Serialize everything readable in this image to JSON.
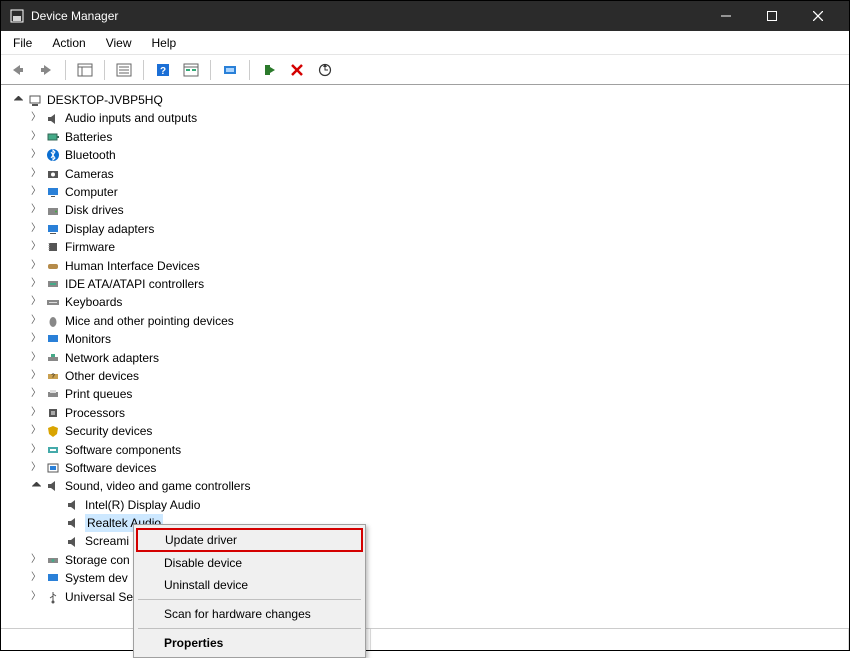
{
  "window": {
    "title": "Device Manager"
  },
  "menu": {
    "file": "File",
    "action": "Action",
    "view": "View",
    "help": "Help"
  },
  "tree": {
    "root": "DESKTOP-JVBP5HQ",
    "categories": [
      {
        "label": "Audio inputs and outputs"
      },
      {
        "label": "Batteries"
      },
      {
        "label": "Bluetooth"
      },
      {
        "label": "Cameras"
      },
      {
        "label": "Computer"
      },
      {
        "label": "Disk drives"
      },
      {
        "label": "Display adapters"
      },
      {
        "label": "Firmware"
      },
      {
        "label": "Human Interface Devices"
      },
      {
        "label": "IDE ATA/ATAPI controllers"
      },
      {
        "label": "Keyboards"
      },
      {
        "label": "Mice and other pointing devices"
      },
      {
        "label": "Monitors"
      },
      {
        "label": "Network adapters"
      },
      {
        "label": "Other devices"
      },
      {
        "label": "Print queues"
      },
      {
        "label": "Processors"
      },
      {
        "label": "Security devices"
      },
      {
        "label": "Software components"
      },
      {
        "label": "Software devices"
      },
      {
        "label": "Sound, video and game controllers",
        "expanded": true,
        "children": [
          {
            "label": "Intel(R) Display Audio"
          },
          {
            "label": "Realtek Audio",
            "selected": true
          },
          {
            "label": "Screaming Bee Audio",
            "truncated_label": "Screami"
          }
        ]
      },
      {
        "label": "Storage controllers",
        "truncated_label": "Storage con"
      },
      {
        "label": "System devices",
        "truncated_label": "System dev"
      },
      {
        "label": "Universal Serial Bus controllers",
        "truncated_label": "Universal Se"
      }
    ]
  },
  "context_menu": {
    "update": "Update driver",
    "disable": "Disable device",
    "uninstall": "Uninstall device",
    "scan": "Scan for hardware changes",
    "properties": "Properties"
  }
}
